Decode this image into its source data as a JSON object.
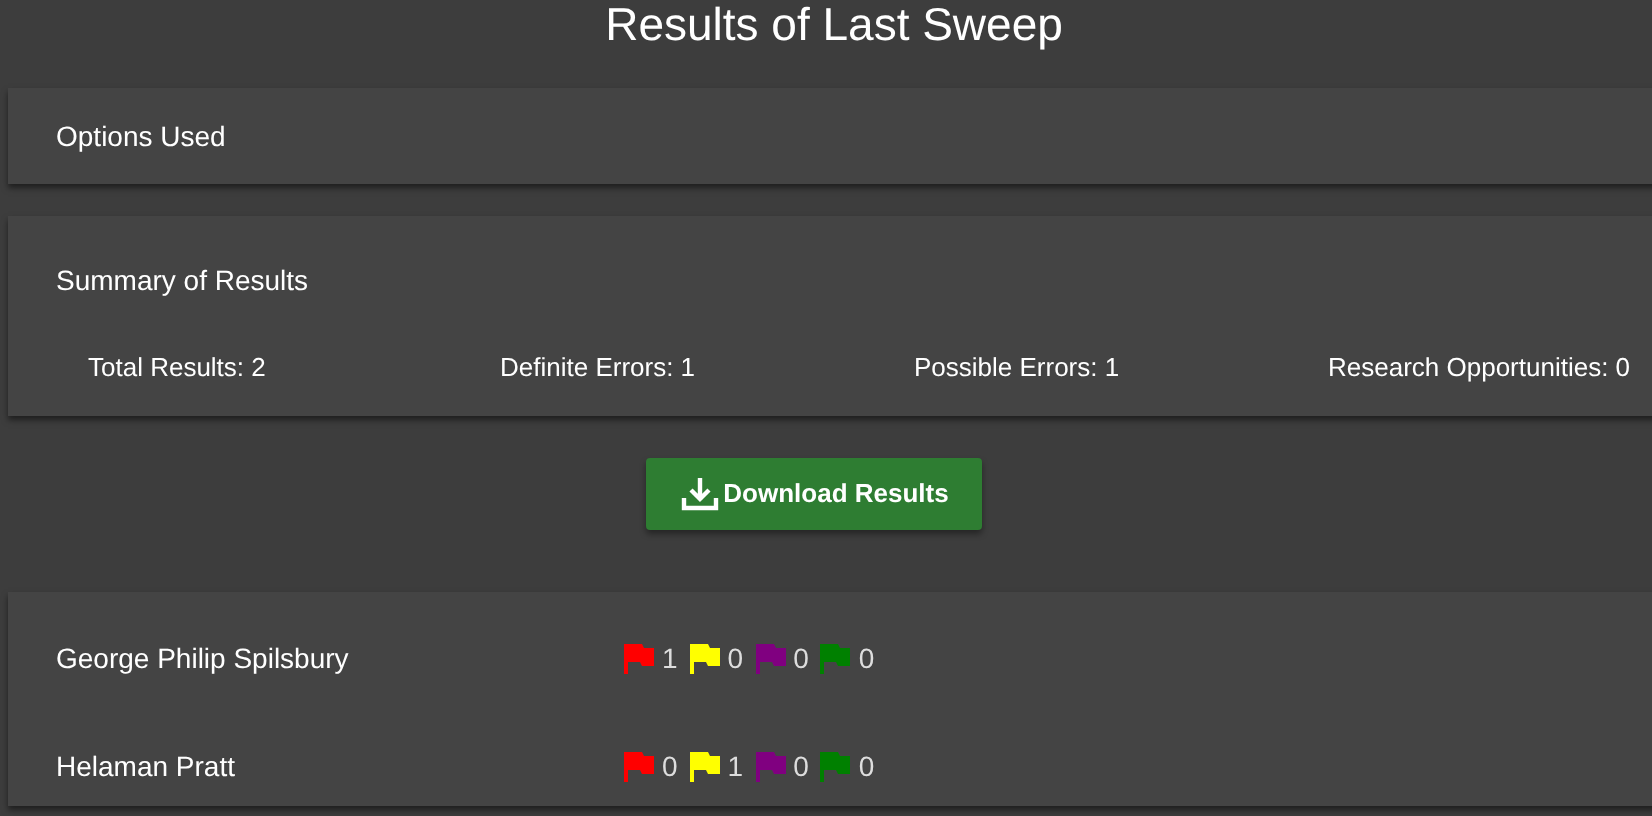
{
  "title": "Results of Last Sweep",
  "options_panel": {
    "heading": "Options Used"
  },
  "summary_panel": {
    "heading": "Summary of Results",
    "stats": [
      "Total Results: 2",
      "Definite Errors: 1",
      "Possible Errors: 1",
      "Research Opportunities: 0"
    ]
  },
  "download_button": {
    "label": "Download Results"
  },
  "results": [
    {
      "name": "George Philip Spilsbury",
      "flags": [
        {
          "color": "#ff0000",
          "count": "1"
        },
        {
          "color": "#ffff00",
          "count": "0"
        },
        {
          "color": "#800080",
          "count": "0"
        },
        {
          "color": "#008000",
          "count": "0"
        }
      ]
    },
    {
      "name": "Helaman Pratt",
      "flags": [
        {
          "color": "#ff0000",
          "count": "0"
        },
        {
          "color": "#ffff00",
          "count": "1"
        },
        {
          "color": "#800080",
          "count": "0"
        },
        {
          "color": "#008000",
          "count": "0"
        }
      ]
    }
  ]
}
